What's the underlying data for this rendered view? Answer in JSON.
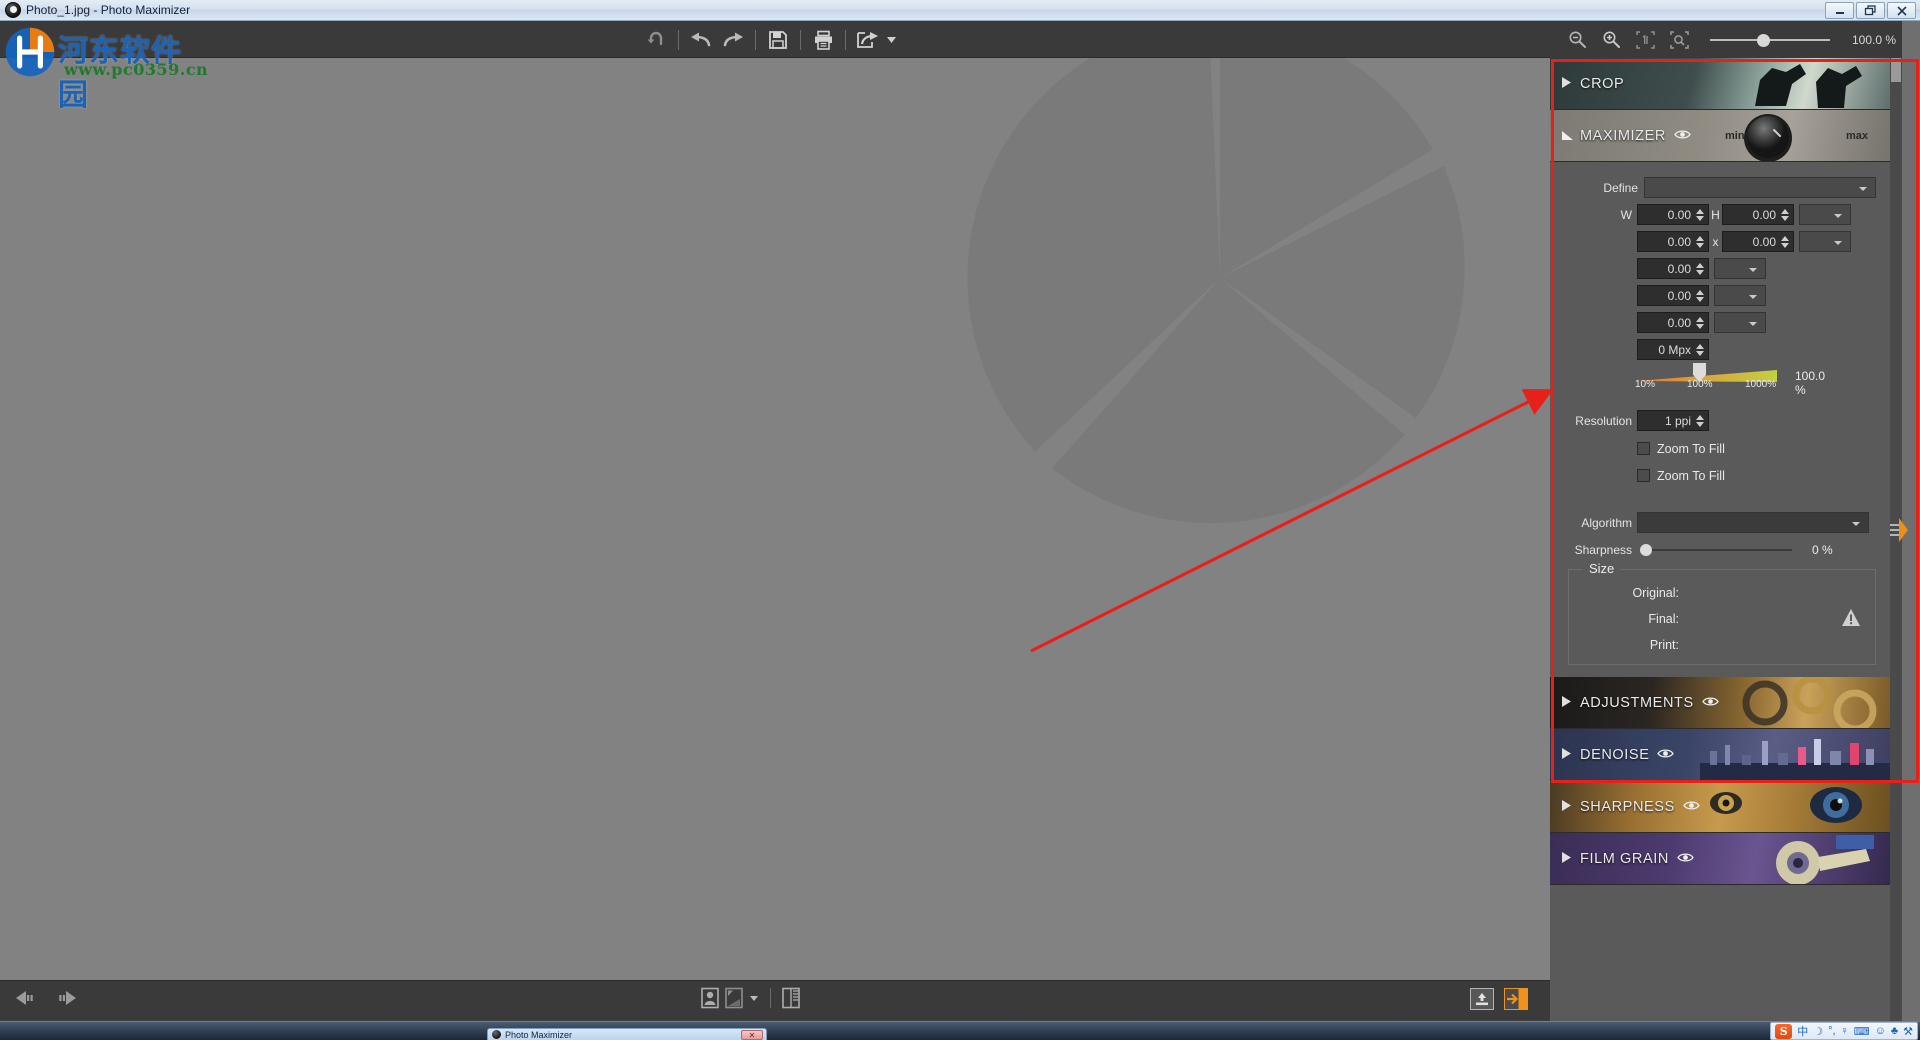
{
  "window": {
    "title": "Photo_1.jpg - Photo Maximizer",
    "minimize_label": "Minimize",
    "restore_label": "Restore",
    "close_label": "Close"
  },
  "watermark": {
    "text_cn": "河东软件园",
    "url": "www.pc0359.cn"
  },
  "toolbar": {
    "items": [
      {
        "name": "reset-button",
        "icon": "reset-icon",
        "label": "Reset"
      },
      {
        "name": "undo-button",
        "icon": "undo-icon",
        "label": "Undo"
      },
      {
        "name": "redo-button",
        "icon": "redo-icon",
        "label": "Redo"
      },
      {
        "name": "save-button",
        "icon": "save-icon",
        "label": "Save"
      },
      {
        "name": "print-button",
        "icon": "print-icon",
        "label": "Print"
      },
      {
        "name": "share-button",
        "icon": "share-icon",
        "label": "Share"
      }
    ]
  },
  "zoombar": {
    "zoom_out_label": "Zoom Out",
    "zoom_in_label": "Zoom In",
    "actual_size_label": "Actual Size",
    "fit_screen_label": "Fit To Screen",
    "zoom_value": "100.0 %",
    "slider_position_percent": 40
  },
  "panel": {
    "sections": [
      {
        "id": "crop",
        "title": "CROP",
        "expanded": false,
        "has_eye": false
      },
      {
        "id": "maximizer",
        "title": "MAXIMIZER",
        "expanded": true,
        "has_eye": true,
        "knob_min": "min",
        "knob_max": "max"
      },
      {
        "id": "adjustments",
        "title": "ADJUSTMENTS",
        "expanded": false,
        "has_eye": true
      },
      {
        "id": "denoise",
        "title": "DENOISE",
        "expanded": false,
        "has_eye": true
      },
      {
        "id": "sharpness",
        "title": "SHARPNESS",
        "expanded": false,
        "has_eye": true
      },
      {
        "id": "filmgrain",
        "title": "FILM GRAIN",
        "expanded": false,
        "has_eye": true
      }
    ]
  },
  "maximizer": {
    "define_label": "Define",
    "define_value": "",
    "w_label": "W",
    "h_label": "H",
    "times_label": "x",
    "w_value": "0.00",
    "h_value": "0.00",
    "wh_unit": "",
    "w2_value": "0.00",
    "h2_value": "0.00",
    "wh2_unit": "",
    "extra_rows": [
      {
        "value": "0.00",
        "unit": ""
      },
      {
        "value": "0.00",
        "unit": ""
      },
      {
        "value": "0.00",
        "unit": ""
      }
    ],
    "mpx_value": "0 Mpx",
    "scale_percent_value": "100.0 %",
    "scale_ticks": [
      "10%",
      "100%",
      "1000%"
    ],
    "scale_thumb_percent": 48,
    "resolution_label": "Resolution",
    "resolution_value": "1 ppi",
    "zoom_to_fill_1": "Zoom To Fill",
    "zoom_to_fill_2": "Zoom To Fill",
    "zoom_to_fill_1_checked": false,
    "zoom_to_fill_2_checked": false,
    "algorithm_label": "Algorithm",
    "algorithm_value": "",
    "sharpness_label": "Sharpness",
    "sharpness_value": "0 %",
    "sharpness_slider_percent": 0,
    "size_group_label": "Size",
    "size_original_label": "Original:",
    "size_original_value": "",
    "size_final_label": "Final:",
    "size_final_value": "",
    "size_print_label": "Print:",
    "size_print_value": "",
    "warning_icon_label": "warning"
  },
  "bottombar": {
    "prev_label": "Previous Image",
    "next_label": "Next Image",
    "compare_label": "Compare",
    "view_mode_label": "View Mode",
    "split_view_label": "Split View",
    "export_label": "Export",
    "panel_toggle_label": "Toggle Panel"
  },
  "taskbar": {
    "dialog_title": "Photo Maximizer",
    "dialog_close": "✕",
    "tray": [
      {
        "name": "sogou-ime-icon",
        "glyph": "S"
      },
      {
        "name": "input-mode-chinese-icon",
        "glyph": "中"
      },
      {
        "name": "moon-icon",
        "glyph": "☽"
      },
      {
        "name": "punctuation-icon",
        "glyph": "°,"
      },
      {
        "name": "microphone-icon",
        "glyph": "♀"
      },
      {
        "name": "keyboard-icon",
        "glyph": "⌨"
      },
      {
        "name": "user-icon",
        "glyph": "☺"
      },
      {
        "name": "skin-icon",
        "glyph": "♣"
      },
      {
        "name": "tools-icon",
        "glyph": "⚒"
      }
    ]
  },
  "annotation": {
    "arrow_color": "#e8201a",
    "box_color": "#e8201a"
  }
}
